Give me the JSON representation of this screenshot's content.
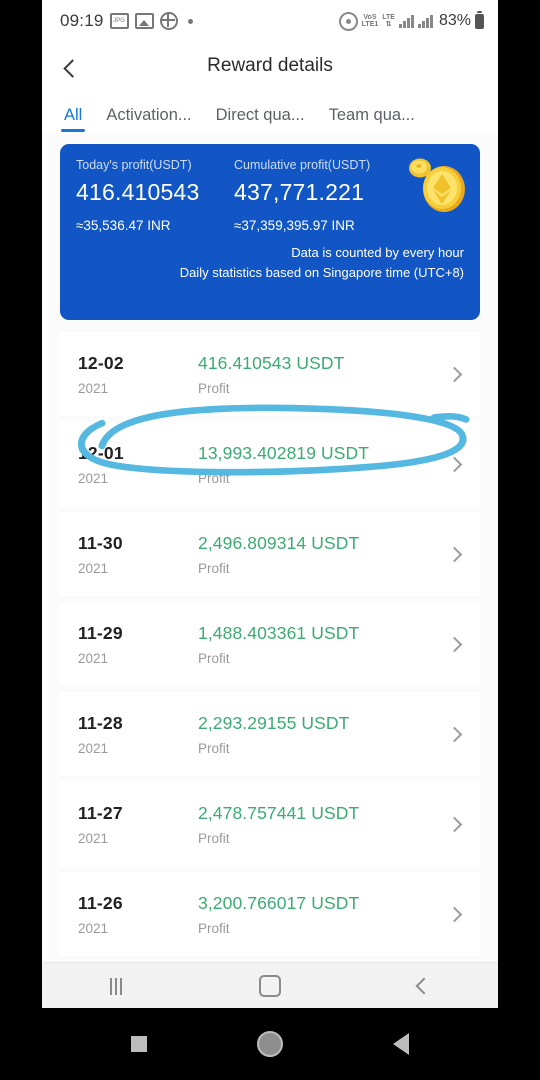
{
  "status_bar": {
    "time": "09:19",
    "battery_percent": "83%",
    "left_icons": [
      "screenshot-icon",
      "image-icon",
      "nfc-icon",
      "dot-icon"
    ],
    "right_icons": [
      "hotspot-icon",
      "volte-icon",
      "lte-icon",
      "signal-bars-icon",
      "signal-bars-icon",
      "battery-icon"
    ],
    "volte_label_top": "VoS",
    "volte_label_bottom": "LTE1",
    "lte_label_top": "LTE",
    "lte_label_bottom": "⇅",
    "screenshot_glyph": "JPG"
  },
  "header": {
    "title": "Reward details",
    "back_icon": "chevron-left-icon"
  },
  "tabs": [
    {
      "label": "All",
      "active": true
    },
    {
      "label": "Activation...",
      "active": false
    },
    {
      "label": "Direct qua...",
      "active": false
    },
    {
      "label": "Team qua...",
      "active": false
    }
  ],
  "summary": {
    "background_color": "#1156c4",
    "today_label": "Today's profit(USDT)",
    "today_value": "416.410543",
    "today_fiat": "≈35,536.47 INR",
    "cumulative_label": "Cumulative profit(USDT)",
    "cumulative_value": "437,771.221",
    "cumulative_fiat": "≈37,359,395.97 INR",
    "note_line_1": "Data is counted by every hour",
    "note_line_2": "Daily statistics based on Singapore time (UTC+8)",
    "coin_icon": "gold-coin-icon"
  },
  "list": {
    "amount_color": "#3cab72",
    "rows": [
      {
        "date": "12-02",
        "year": "2021",
        "amount": "416.410543 USDT",
        "type": "Profit"
      },
      {
        "date": "12-01",
        "year": "2021",
        "amount": "13,993.402819 USDT",
        "type": "Profit"
      },
      {
        "date": "11-30",
        "year": "2021",
        "amount": "2,496.809314 USDT",
        "type": "Profit"
      },
      {
        "date": "11-29",
        "year": "2021",
        "amount": "1,488.403361 USDT",
        "type": "Profit"
      },
      {
        "date": "11-28",
        "year": "2021",
        "amount": "2,293.29155 USDT",
        "type": "Profit"
      },
      {
        "date": "11-27",
        "year": "2021",
        "amount": "2,478.757441 USDT",
        "type": "Profit"
      },
      {
        "date": "11-26",
        "year": "2021",
        "amount": "3,200.766017 USDT",
        "type": "Profit"
      }
    ]
  },
  "annotation": {
    "shape": "hand-drawn-ellipse",
    "color": "#54b8e0",
    "target_row_date": "12-01"
  },
  "nav_bar": {
    "recent_icon": "recent-apps-icon",
    "home_icon": "home-icon",
    "back_icon": "back-icon"
  },
  "system_nav": {
    "square_icon": "stop-square-icon",
    "circle_icon": "record-circle-icon",
    "triangle_icon": "play-triangle-icon"
  }
}
